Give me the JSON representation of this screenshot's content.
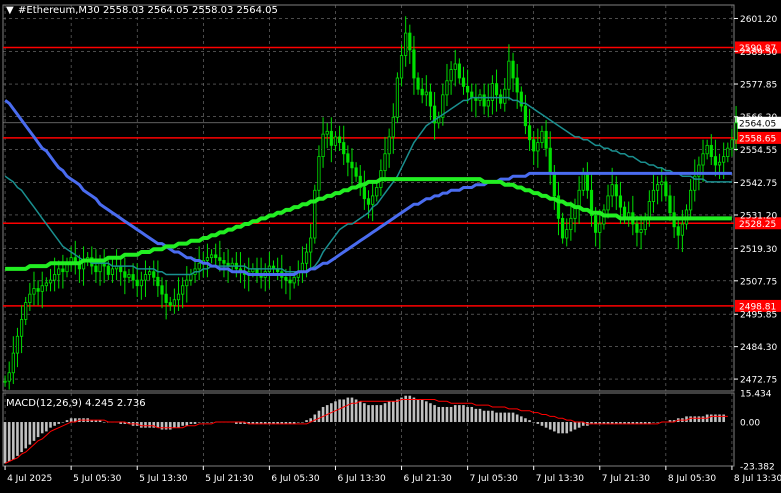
{
  "header": {
    "menu_glyph": "▼",
    "text": "#Ethereum,M30  2558.03 2564.05 2558.03 2564.05"
  },
  "macd": {
    "label": "MACD(12,26,9) 4.245 2.736",
    "axis": [
      {
        "label": "15.434",
        "value": 15.434
      },
      {
        "label": "0.00",
        "value": 0
      },
      {
        "label": "-23.382",
        "value": -23.382
      }
    ]
  },
  "price_axis": [
    {
      "label": "2601.20",
      "value": 2601.2
    },
    {
      "label": "2589.50",
      "value": 2589.5
    },
    {
      "label": "2577.85",
      "value": 2577.85
    },
    {
      "label": "2566.20",
      "value": 2566.2
    },
    {
      "label": "2554.55",
      "value": 2554.55
    },
    {
      "label": "2542.75",
      "value": 2542.75
    },
    {
      "label": "2531.20",
      "value": 2531.2
    },
    {
      "label": "2519.30",
      "value": 2519.3
    },
    {
      "label": "2507.75",
      "value": 2507.75
    },
    {
      "label": "2495.85",
      "value": 2495.85
    },
    {
      "label": "2484.30",
      "value": 2484.3
    },
    {
      "label": "2472.75",
      "value": 2472.75
    }
  ],
  "levels": [
    {
      "label": "2590.87",
      "value": 2590.87
    },
    {
      "label": "2558.65",
      "value": 2558.65
    },
    {
      "label": "2528.25",
      "value": 2528.25
    },
    {
      "label": "2498.81",
      "value": 2498.81
    }
  ],
  "current_price": {
    "label": "2564.05",
    "value": 2564.05
  },
  "time_axis": [
    {
      "label": "4 Jul 2025",
      "index": 0
    },
    {
      "label": "5 Jul 05:30",
      "index": 16
    },
    {
      "label": "5 Jul 13:30",
      "index": 32
    },
    {
      "label": "5 Jul 21:30",
      "index": 48
    },
    {
      "label": "6 Jul 05:30",
      "index": 64
    },
    {
      "label": "6 Jul 13:30",
      "index": 80
    },
    {
      "label": "6 Jul 21:30",
      "index": 96
    },
    {
      "label": "7 Jul 05:30",
      "index": 112
    },
    {
      "label": "7 Jul 13:30",
      "index": 128
    },
    {
      "label": "7 Jul 21:30",
      "index": 144
    },
    {
      "label": "8 Jul 05:30",
      "index": 160
    },
    {
      "label": "8 Jul 13:30",
      "index": 176
    }
  ],
  "colors": {
    "background": "#000000",
    "grid": "#7a7a7a",
    "bull": "#00e000",
    "bear": "#00e000",
    "level_line": "#ff0000",
    "level_box": "#ff0000",
    "ma_fast": "#1a8f8f",
    "ma_mid": "#4a6cf0",
    "ma_slow": "#22ee22",
    "macd_hist": "#c0c0c0",
    "macd_signal": "#ff0000",
    "axis_text": "#ffffff"
  },
  "chart_data": {
    "type": "candlestick",
    "symbol": "#Ethereum",
    "timeframe": "M30",
    "ohlc_last": {
      "open": 2558.03,
      "high": 2564.05,
      "low": 2558.03,
      "close": 2564.05
    },
    "ylim": [
      2468.5,
      2606.0
    ],
    "macd_ylim": [
      -23.382,
      15.434
    ],
    "bar_count": 177,
    "close": [
      2472,
      2475,
      2482,
      2488,
      2494,
      2500,
      2503,
      2505,
      2504,
      2506,
      2507,
      2508,
      2510,
      2512,
      2511,
      2514,
      2516,
      2514,
      2512,
      2515,
      2516,
      2513,
      2511,
      2514,
      2513,
      2510,
      2512,
      2513,
      2511,
      2509,
      2510,
      2508,
      2506,
      2508,
      2510,
      2511,
      2509,
      2506,
      2503,
      2500,
      2499,
      2501,
      2503,
      2506,
      2508,
      2510,
      2512,
      2514,
      2515,
      2516,
      2517,
      2516,
      2515,
      2514,
      2513,
      2514,
      2512,
      2511,
      2510,
      2511,
      2512,
      2510,
      2509,
      2511,
      2513,
      2512,
      2511,
      2509,
      2508,
      2507,
      2509,
      2511,
      2514,
      2518,
      2523,
      2540,
      2552,
      2560,
      2561,
      2556,
      2559,
      2557,
      2553,
      2550,
      2548,
      2545,
      2541,
      2537,
      2535,
      2538,
      2541,
      2547,
      2553,
      2559,
      2566,
      2580,
      2588,
      2596,
      2590,
      2580,
      2576,
      2574,
      2575,
      2570,
      2564,
      2566,
      2574,
      2579,
      2583,
      2585,
      2580,
      2577,
      2575,
      2573,
      2572,
      2574,
      2570,
      2572,
      2578,
      2574,
      2571,
      2576,
      2586,
      2580,
      2575,
      2570,
      2563,
      2558,
      2554,
      2557,
      2561,
      2555,
      2546,
      2538,
      2530,
      2523,
      2526,
      2530,
      2534,
      2540,
      2546,
      2540,
      2531,
      2525,
      2528,
      2533,
      2538,
      2542,
      2538,
      2534,
      2530,
      2532,
      2528,
      2525,
      2526,
      2530,
      2536,
      2540,
      2542,
      2543,
      2538,
      2532,
      2527,
      2524,
      2528,
      2533,
      2540,
      2545,
      2549,
      2553,
      2556,
      2552,
      2549,
      2550,
      2552,
      2555,
      2558,
      2564
    ],
    "ma_fast": [
      2545,
      2544,
      2543,
      2541,
      2540,
      2538,
      2536,
      2534,
      2532,
      2530,
      2528,
      2526,
      2524,
      2522,
      2520,
      2519,
      2518,
      2517,
      2516,
      2515,
      2515,
      2514,
      2514,
      2514,
      2514,
      2514,
      2513,
      2513,
      2513,
      2513,
      2513,
      2513,
      2512,
      2512,
      2512,
      2512,
      2512,
      2511,
      2511,
      2510,
      2510,
      2510,
      2510,
      2510,
      2510,
      2510,
      2511,
      2511,
      2512,
      2512,
      2513,
      2513,
      2513,
      2513,
      2513,
      2513,
      2513,
      2513,
      2513,
      2512,
      2512,
      2512,
      2512,
      2512,
      2512,
      2512,
      2512,
      2512,
      2511,
      2511,
      2511,
      2511,
      2511,
      2511,
      2512,
      2513,
      2515,
      2518,
      2520,
      2522,
      2524,
      2526,
      2527,
      2528,
      2528,
      2529,
      2530,
      2531,
      2532,
      2534,
      2535,
      2537,
      2539,
      2541,
      2543,
      2545,
      2548,
      2551,
      2554,
      2557,
      2559,
      2561,
      2563,
      2564,
      2565,
      2566,
      2567,
      2568,
      2569,
      2570,
      2571,
      2572,
      2572,
      2573,
      2573,
      2573,
      2573,
      2573,
      2573,
      2573,
      2573,
      2573,
      2573,
      2572,
      2572,
      2571,
      2571,
      2570,
      2569,
      2568,
      2567,
      2566,
      2565,
      2564,
      2563,
      2562,
      2561,
      2560,
      2559,
      2559,
      2558,
      2558,
      2557,
      2556,
      2556,
      2555,
      2555,
      2554,
      2554,
      2553,
      2553,
      2552,
      2552,
      2551,
      2550,
      2550,
      2549,
      2549,
      2548,
      2548,
      2547,
      2547,
      2546,
      2546,
      2545,
      2545,
      2545,
      2544,
      2544,
      2544,
      2543,
      2543,
      2543,
      2543,
      2543,
      2543,
      2543
    ],
    "ma_mid": [
      2572,
      2571,
      2569,
      2567,
      2565,
      2563,
      2561,
      2559,
      2557,
      2555,
      2554,
      2552,
      2550,
      2548,
      2547,
      2545,
      2544,
      2543,
      2542,
      2540,
      2539,
      2538,
      2537,
      2535,
      2534,
      2533,
      2532,
      2531,
      2530,
      2529,
      2528,
      2527,
      2526,
      2525,
      2524,
      2523,
      2522,
      2521,
      2521,
      2520,
      2519,
      2518,
      2518,
      2517,
      2516,
      2516,
      2515,
      2515,
      2514,
      2514,
      2513,
      2513,
      2512,
      2512,
      2512,
      2511,
      2511,
      2511,
      2511,
      2510,
      2510,
      2510,
      2510,
      2510,
      2510,
      2510,
      2510,
      2510,
      2510,
      2510,
      2510,
      2511,
      2511,
      2511,
      2512,
      2512,
      2513,
      2514,
      2514,
      2515,
      2516,
      2517,
      2518,
      2519,
      2520,
      2521,
      2522,
      2523,
      2524,
      2525,
      2526,
      2527,
      2528,
      2529,
      2530,
      2531,
      2532,
      2533,
      2534,
      2535,
      2535,
      2536,
      2537,
      2537,
      2538,
      2538,
      2539,
      2539,
      2540,
      2540,
      2540,
      2541,
      2541,
      2541,
      2542,
      2542,
      2542,
      2543,
      2543,
      2543,
      2544,
      2544,
      2544,
      2545,
      2545,
      2545,
      2545,
      2546,
      2546,
      2546,
      2546,
      2546,
      2546,
      2546,
      2546,
      2546,
      2546,
      2546,
      2546,
      2546,
      2546,
      2546,
      2546,
      2546,
      2546,
      2546,
      2546,
      2546,
      2546,
      2546,
      2546,
      2546,
      2546,
      2546,
      2546,
      2546,
      2546,
      2546,
      2546,
      2546,
      2546,
      2546,
      2546,
      2546,
      2546,
      2546,
      2546,
      2546,
      2546,
      2546,
      2546,
      2546,
      2546,
      2546,
      2546,
      2546,
      2546
    ],
    "ma_slow": [
      2512,
      2512,
      2512,
      2512,
      2512,
      2512,
      2513,
      2513,
      2513,
      2513,
      2513,
      2514,
      2514,
      2514,
      2514,
      2514,
      2514,
      2514,
      2514,
      2515,
      2515,
      2515,
      2515,
      2515,
      2515,
      2516,
      2516,
      2516,
      2516,
      2517,
      2517,
      2517,
      2517,
      2518,
      2518,
      2518,
      2519,
      2519,
      2519,
      2520,
      2520,
      2520,
      2521,
      2521,
      2521,
      2522,
      2522,
      2522,
      2523,
      2523,
      2524,
      2524,
      2525,
      2525,
      2526,
      2526,
      2527,
      2527,
      2528,
      2528,
      2529,
      2529,
      2530,
      2530,
      2531,
      2531,
      2532,
      2532,
      2533,
      2533,
      2534,
      2534,
      2535,
      2535,
      2536,
      2536,
      2537,
      2537,
      2538,
      2538,
      2539,
      2539,
      2540,
      2540,
      2541,
      2541,
      2542,
      2542,
      2543,
      2543,
      2543,
      2544,
      2544,
      2544,
      2544,
      2544,
      2544,
      2544,
      2544,
      2544,
      2544,
      2544,
      2544,
      2544,
      2544,
      2544,
      2544,
      2544,
      2544,
      2544,
      2544,
      2544,
      2544,
      2544,
      2544,
      2544,
      2543,
      2543,
      2543,
      2543,
      2543,
      2542,
      2542,
      2542,
      2541,
      2541,
      2540,
      2540,
      2539,
      2539,
      2538,
      2538,
      2537,
      2537,
      2536,
      2536,
      2535,
      2535,
      2534,
      2534,
      2533,
      2533,
      2532,
      2532,
      2532,
      2531,
      2531,
      2531,
      2531,
      2530,
      2530,
      2530,
      2530,
      2530,
      2530,
      2530,
      2530,
      2530,
      2530,
      2530,
      2530,
      2530,
      2530,
      2530,
      2530,
      2530,
      2530,
      2530,
      2530,
      2530,
      2530,
      2530,
      2530,
      2530,
      2530,
      2530,
      2530
    ],
    "macd_hist": [
      -22,
      -21,
      -20,
      -18,
      -16,
      -14,
      -12,
      -10,
      -8,
      -6,
      -5,
      -3,
      -2,
      -1,
      0,
      1,
      2,
      2,
      2,
      2,
      2,
      1,
      1,
      1,
      0,
      0,
      0,
      0,
      -1,
      -1,
      -1,
      -2,
      -2,
      -3,
      -3,
      -3,
      -3,
      -3,
      -4,
      -4,
      -4,
      -3,
      -3,
      -2,
      -2,
      -1,
      -1,
      0,
      0,
      0,
      0,
      0,
      0,
      0,
      0,
      0,
      -1,
      -1,
      -1,
      -1,
      -1,
      -1,
      -1,
      -1,
      -1,
      -1,
      -1,
      -1,
      -1,
      -1,
      -1,
      0,
      0,
      1,
      2,
      4,
      6,
      8,
      9,
      10,
      11,
      12,
      12,
      13,
      13,
      12,
      11,
      10,
      9,
      9,
      9,
      9,
      10,
      11,
      11,
      12,
      13,
      14,
      14,
      13,
      12,
      12,
      11,
      10,
      9,
      8,
      8,
      8,
      8,
      9,
      9,
      9,
      8,
      8,
      7,
      7,
      6,
      6,
      6,
      5,
      5,
      5,
      5,
      5,
      4,
      3,
      2,
      1,
      0,
      -1,
      -2,
      -3,
      -4,
      -5,
      -6,
      -6,
      -6,
      -5,
      -4,
      -3,
      -2,
      -2,
      -1,
      -1,
      -1,
      -1,
      -1,
      -1,
      -1,
      -1,
      -1,
      -1,
      -1,
      -1,
      -1,
      -1,
      -1,
      0,
      0,
      0,
      0,
      1,
      1,
      2,
      2,
      3,
      3,
      3,
      3,
      3,
      4,
      4,
      4,
      4,
      4
    ],
    "macd_signal": [
      -22,
      -21,
      -20,
      -19,
      -17,
      -16,
      -14,
      -12,
      -10,
      -9,
      -7,
      -5,
      -4,
      -3,
      -2,
      -1,
      0,
      0,
      1,
      1,
      1,
      1,
      1,
      1,
      1,
      0,
      0,
      0,
      0,
      0,
      -1,
      -1,
      -1,
      -2,
      -2,
      -2,
      -2,
      -3,
      -3,
      -3,
      -3,
      -3,
      -3,
      -3,
      -2,
      -2,
      -2,
      -1,
      -1,
      -1,
      -1,
      0,
      0,
      0,
      0,
      0,
      0,
      0,
      0,
      -1,
      -1,
      -1,
      -1,
      -1,
      -1,
      -1,
      -1,
      -1,
      -1,
      -1,
      -1,
      -1,
      -1,
      -1,
      0,
      1,
      2,
      3,
      4,
      5,
      6,
      7,
      8,
      9,
      10,
      10,
      11,
      11,
      11,
      11,
      11,
      11,
      11,
      11,
      11,
      11,
      12,
      12,
      12,
      12,
      12,
      12,
      12,
      12,
      12,
      11,
      11,
      11,
      10,
      10,
      10,
      10,
      10,
      10,
      9,
      9,
      9,
      9,
      8,
      8,
      8,
      8,
      7,
      7,
      7,
      6,
      6,
      6,
      5,
      5,
      4,
      4,
      3,
      3,
      2,
      2,
      1,
      1,
      0,
      0,
      0,
      -1,
      -1,
      -1,
      -1,
      -1,
      -1,
      -1,
      -1,
      -1,
      -1,
      -1,
      -1,
      -1,
      -1,
      -1,
      -1,
      -1,
      -1,
      0,
      0,
      0,
      0,
      1,
      1,
      1,
      2,
      2,
      2,
      2,
      2,
      3,
      3,
      3,
      3,
      3
    ]
  }
}
